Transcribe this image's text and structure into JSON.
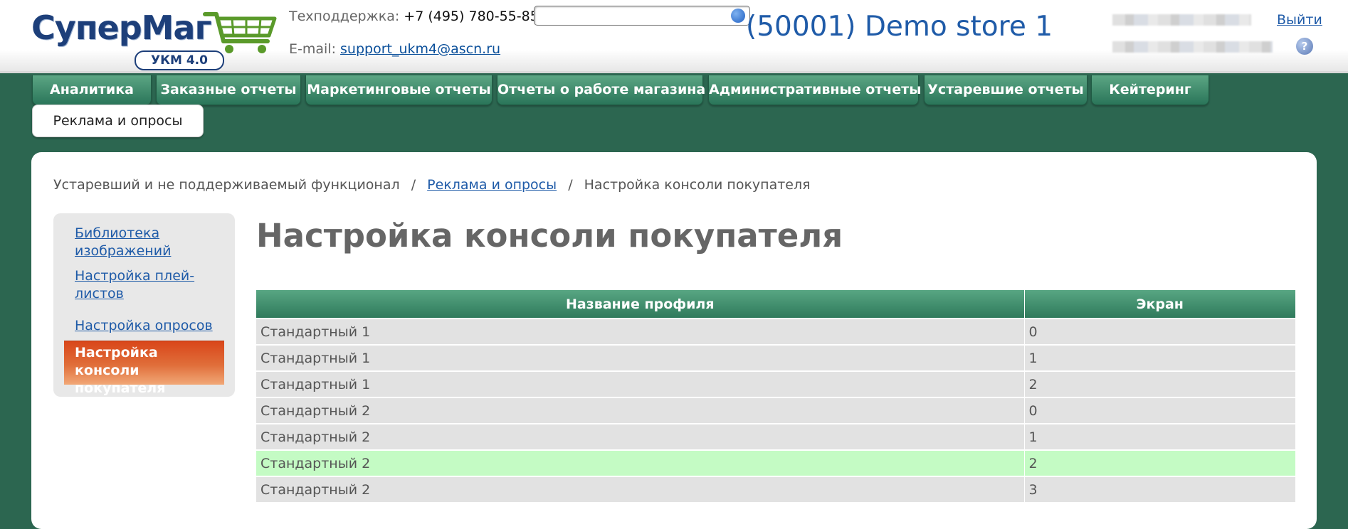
{
  "header": {
    "logo_text": "СуперМаг",
    "logo_badge": "УКМ 4.0",
    "support_label": "Техподдержка:",
    "support_phone": "+7 (495) 780-55-85",
    "email_label": "E-mail:",
    "email": "support_ukm4@ascn.ru",
    "search_value": "",
    "store_title": "(50001) Demo store 1",
    "logout_label": "Выйти",
    "help_label": "?"
  },
  "nav": {
    "tabs": [
      {
        "label": "Аналитика"
      },
      {
        "label": "Заказные отчеты"
      },
      {
        "label": "Маркетинговые отчеты"
      },
      {
        "label": "Отчеты о работе магазина"
      },
      {
        "label": "Административные отчеты"
      },
      {
        "label": "Устаревшие отчеты"
      },
      {
        "label": "Кейтеринг"
      },
      {
        "label": "Реклама и опросы",
        "active": true
      }
    ]
  },
  "breadcrumb": {
    "root": "Устаревший и не поддерживаемый функционал",
    "section": "Реклама и опросы",
    "current": "Настройка консоли покупателя",
    "separator": "/"
  },
  "sidebar": {
    "items": [
      {
        "label": "Библиотека изображений"
      },
      {
        "label": "Настройка плей-листов"
      },
      {
        "label": "Настройка опросов"
      },
      {
        "label": "Настройка консоли покупателя",
        "active": true
      }
    ]
  },
  "main": {
    "title": "Настройка консоли покупателя",
    "table": {
      "headers": [
        "Название профиля",
        "Экран"
      ],
      "rows": [
        [
          "Стандартный 1",
          "0"
        ],
        [
          "Стандартный 1",
          "1"
        ],
        [
          "Стандартный 1",
          "2"
        ],
        [
          "Стандартный 2",
          "0"
        ],
        [
          "Стандартный 2",
          "1"
        ],
        [
          "Стандартный 2",
          "2"
        ],
        [
          "Стандартный 2",
          "3"
        ]
      ],
      "selected_row": 5
    }
  },
  "colors": {
    "background": "#2c6650",
    "tab": "#2f7a5c",
    "link": "#1f5ba8",
    "active_sidebar": "#d9461a",
    "selected_row": "#c4fbc4"
  }
}
